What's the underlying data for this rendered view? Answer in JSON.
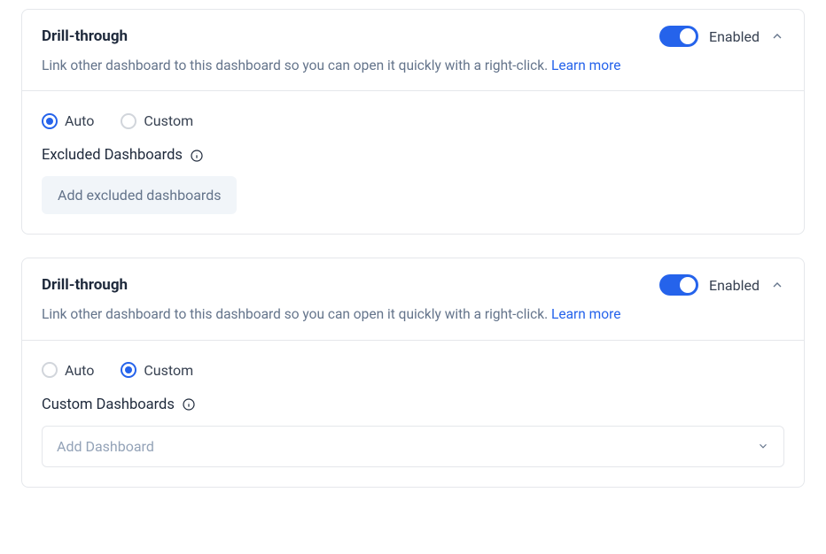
{
  "panels": [
    {
      "title": "Drill-through",
      "toggle_label": "Enabled",
      "description": "Link other dashboard to this dashboard so you can open it quickly with a right-click. ",
      "learn_more": "Learn more",
      "radio": {
        "auto": "Auto",
        "custom": "Custom",
        "selected": "auto"
      },
      "section_label": "Excluded Dashboards",
      "button_label": "Add excluded dashboards"
    },
    {
      "title": "Drill-through",
      "toggle_label": "Enabled",
      "description": "Link other dashboard to this dashboard so you can open it quickly with a right-click. ",
      "learn_more": "Learn more",
      "radio": {
        "auto": "Auto",
        "custom": "Custom",
        "selected": "custom"
      },
      "section_label": "Custom Dashboards",
      "select_placeholder": "Add Dashboard"
    }
  ]
}
